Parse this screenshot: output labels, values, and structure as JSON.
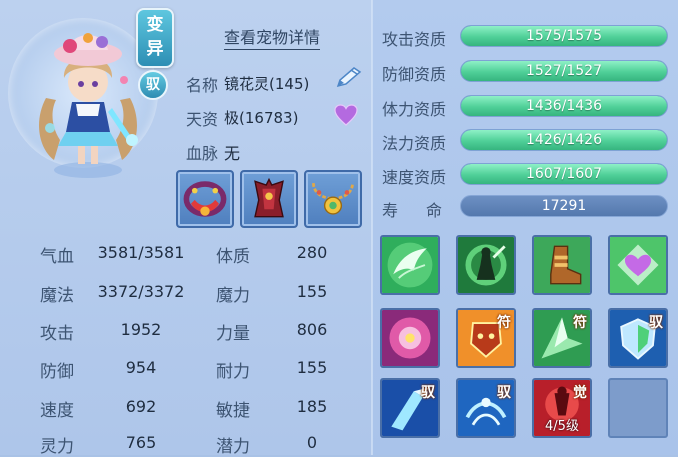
{
  "header": {
    "variant_badge": "变异",
    "tamed_badge": "驭",
    "detail_link": "查看宠物详情"
  },
  "info": {
    "name_label": "名称",
    "name_value": "镜花灵(145)",
    "talent_label": "天资",
    "talent_value": "极(16783)",
    "bloodline_label": "血脉",
    "bloodline_value": "无"
  },
  "stats": [
    {
      "label": "气血",
      "value": "3581/3581"
    },
    {
      "label": "魔法",
      "value": "3372/3372"
    },
    {
      "label": "攻击",
      "value": "1952"
    },
    {
      "label": "防御",
      "value": "954"
    },
    {
      "label": "速度",
      "value": "692"
    },
    {
      "label": "灵力",
      "value": "765"
    }
  ],
  "attributes": [
    {
      "label": "体质",
      "value": "280"
    },
    {
      "label": "魔力",
      "value": "155"
    },
    {
      "label": "力量",
      "value": "806"
    },
    {
      "label": "耐力",
      "value": "155"
    },
    {
      "label": "敏捷",
      "value": "185"
    },
    {
      "label": "潜力",
      "value": "0"
    }
  ],
  "aptitudes": [
    {
      "label": "攻击资质",
      "value": "1575/1575",
      "fill": 1.0
    },
    {
      "label": "防御资质",
      "value": "1527/1527",
      "fill": 1.0
    },
    {
      "label": "体力资质",
      "value": "1436/1436",
      "fill": 1.0
    },
    {
      "label": "法力资质",
      "value": "1426/1426",
      "fill": 1.0
    },
    {
      "label": "速度资质",
      "value": "1607/1607",
      "fill": 1.0
    }
  ],
  "lifespan": {
    "label": "寿　命",
    "value": "17291"
  },
  "skills": {
    "tag_fu": "符",
    "tag_yu": "驭",
    "tag_jue": "觉",
    "awakening_level": "4/5级"
  },
  "colors": {
    "aptitude_fill": "#4fcf98",
    "panel_bg": "#aec6ea"
  }
}
